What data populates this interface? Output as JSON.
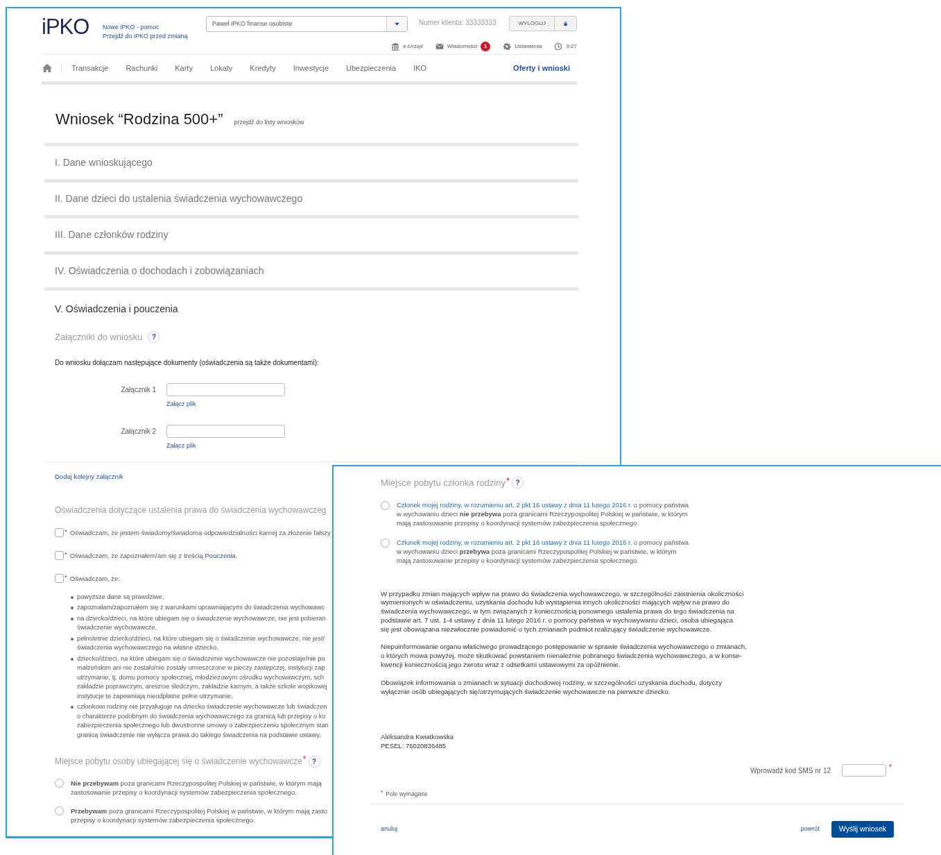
{
  "header": {
    "logo": "iPKO",
    "help_links": [
      "Nowe iPKO - pomoc",
      "Przejdź do iPKO przed zmianą"
    ],
    "profile_select": {
      "value": "Paweł iPKO finanse osobiste"
    },
    "client_number": "Numer klienta: 33333333",
    "logout_button": "WYLOGUJ",
    "utilities": [
      {
        "kind": "bank",
        "label": "e-Urząd"
      },
      {
        "kind": "mail",
        "label": "Wiadomości",
        "badge": "1"
      },
      {
        "kind": "gear",
        "label": "Ustawienia"
      },
      {
        "kind": "clock",
        "label": "9:27"
      }
    ]
  },
  "nav": {
    "items": [
      {
        "label": "Transakcje",
        "selected": false
      },
      {
        "label": "Rachunki",
        "selected": false
      },
      {
        "label": "Karty",
        "selected": false
      },
      {
        "label": "Lokaty",
        "selected": false
      },
      {
        "label": "Kredyty",
        "selected": false
      },
      {
        "label": "Inwestycje",
        "selected": false
      },
      {
        "label": "Ubezpieczenia",
        "selected": false
      },
      {
        "label": "IKO",
        "selected": false
      }
    ],
    "right_items": [
      {
        "label": "Oferty i wnioski",
        "selected": true
      }
    ]
  },
  "title": "Wniosek “Rodzina 500+”",
  "title_link": "przejdź do listy wniosków",
  "sections": [
    {
      "label": "I. Dane wnioskującego",
      "expanded": false
    },
    {
      "label": "II. Dane dzieci do ustalenia świadczenia wychowawczego",
      "expanded": false
    },
    {
      "label": "III. Dane członków rodziny",
      "expanded": false
    },
    {
      "label": "IV. Oświadczenia o dochodach i zobowiązaniach",
      "expanded": false
    },
    {
      "label": "V. Oświadczenia i pouczenia",
      "expanded": true
    }
  ],
  "attachments": {
    "heading": "Załączniki do wniosku",
    "help": "?",
    "intro": "Do wniosku dołączam następujące dokumenty (oświadczenia są także dokumentami):",
    "items": [
      {
        "label": "Załącznik 1",
        "link": "Załącz plik"
      },
      {
        "label": "Załącznik 2",
        "link": "Załącz plik"
      }
    ],
    "add_link": "Dodaj kolejny załącznik"
  },
  "declarations": {
    "heading": "Oświadczenia dotyczące ustalenia prawa do świadczenia wychowawczeg",
    "items": [
      {
        "mark": "*",
        "checked": false,
        "text": "Oświadczam, że jestem świadomy/świadoma odpowiedzialności karnej za złożenie fałszy"
      },
      {
        "mark": "*",
        "checked": false,
        "text": "Oświadczam, że zapoznałem/am się z treścią ",
        "link": "Pouczenia",
        "after": "."
      },
      {
        "mark": "*",
        "checked": false,
        "text": "Oświadczam, że:",
        "bullets": [
          [
            "powyższe dane są prawdziwe,"
          ],
          [
            "zapoznałam/zapoznałem się z warunkami uprawniającymi do świadczenia wychowawc"
          ],
          [
            "na dziecko/dzieci, na które ubiegam się o świadczenie wychowawcze, nie jest pobieran",
            "świadczenie wychowawcze,"
          ],
          [
            "pełnoletnie dziecko/dzieci, na które ubiegam się o świadczenie wychowawcze, nie jest/",
            "świadczenia wychowawczego na własne dziecko,"
          ],
          [
            "dziecko/dzieci, na które ubiegam się o świadczenie wychowawcze nie pozostaje/nie po",
            "małżeńskim ani nie zostało/nie zostały umieszczone w pieczy zastępczej, instytucji zap",
            "utrzymanie, tj. domu pomocy społecznej, młodzieżowym ośrodku wychowawczym, sch",
            "zakładzie poprawczym, areszcie śledczym, zakładzie karnym, a także szkole wojskowej",
            "instytucje te zapewniają nieodpłatne pełne utrzymanie,"
          ],
          [
            "członkowi rodziny nie przysługuje na dziecko świadczenie wychowawcze lub świadczen",
            "o charakterze podobnym do świadczenia wychowawczego za granicą lub przepisy o ko",
            "zabezpieczenia społecznego lub dwustronne umowy o zabezpieczeniu społecznym stan",
            "granicą świadczenie nie wyłącza prawa do takiego świadczenia na podstawie ustawy."
          ]
        ]
      }
    ]
  },
  "residence": {
    "heading": "Miejsce pobytu osoby ubiegającej się o świadczenie wychowawcze",
    "mark": "*",
    "help": "?",
    "options": [
      {
        "selected": false,
        "lines": [
          "**Nie przebywam** poza granicami Rzeczypospolitej Polskiej w państwie, w którym mają",
          "zastosowanie przepisy o koordynacji systemów zabezpieczenia społecznego."
        ]
      },
      {
        "selected": false,
        "lines": [
          "**Przebywam** poza granicami Rzeczypospolitej Polskiej w państwie, w którym mają zasto",
          "przepisy o koordynacji systemów zabezpieczenia społecznego."
        ]
      }
    ]
  },
  "family_residence": {
    "heading": "Miejsce pobytu członka rodziny",
    "mark": "*",
    "help": "?",
    "options": [
      {
        "selected": false,
        "link": "Członek mojej rodziny, w rozumieniu art. 2 pkt 16 ustawy z dnia 11 lutego 2016 r.",
        "text": " o pomocy państwa w wychowaniu dzieci **nie przebywa** poza granicami Rzeczypospolitej Polskiej w państwie, w którym mają zastosowanie przepisy o koordynacji systemów zabezpieczenia społecznego."
      },
      {
        "selected": false,
        "link": "Członek mojej rodziny, w rozumieniu art. 2 pkt 16 ustawy z dnia 11 lutego 2016 r.",
        "text": " o pomocy państwa w wychowaniu dzieci **przebywa** poza granicami Rzeczypospolitej Polskiej w państwie, w którym mają zastosowanie przepisy o koordynacji systemów zabezpieczenia społecznego."
      }
    ]
  },
  "notice": [
    "W przypadku zmian mających wpływ na prawo do świadczenia wychowawczego, w szczególności zaistnienia okoliczności\nwymienionych w oświadczeniu, uzyskania dochodu lub wystąpienia innych okoliczności mających wpływ na prawo do\nświadczenia wychowawczego, w tym związanych z koniecznością ponownego ustalenia prawa do tego świadczenia na\npodstawie art. 7 ust. 1-4 ustawy z dnia 11 lutego 2016 r. o pomocy państwa w wychowywaniu dzieci, osoba ubiegająca\nsię jest obowiązana niezwłocznie powiadomić o tych zmianach podmiot realizujący świadczenie wychowawcze.",
    "Niepoinformowanie organu właściwego prowadzącego postępowanie w sprawie świadczenia wychowawczego o zmianach,\no których mowa powyżej, może skutkować powstaniem nienależnie pobranego świadczenia wychowawczego, a w konse-\nkwencji  koniecznością jego zwrotu wraz z odsetkami ustawowymi za opóźnienie.",
    "Obowiązek informowania o zmianach w sytuacji dochodowej rodziny, w szczególności uzyskania dochodu, dotyczy\nwyłącznie osób ubiegających się/otrzymujących świadczenie wychowawcze na pierwsze dziecko."
  ],
  "signature": {
    "name": "Aleksandra Kwiatkowska",
    "pesel": "PESEL: 76020836485"
  },
  "sms": {
    "label": "Wprowadź kod SMS nr 12",
    "mark": "*"
  },
  "required_note": {
    "mark": "*",
    "text": "Pole wymagane"
  },
  "actions": {
    "cancel": "anuluj",
    "back": "powrót",
    "submit": "Wyślij wniosek"
  }
}
